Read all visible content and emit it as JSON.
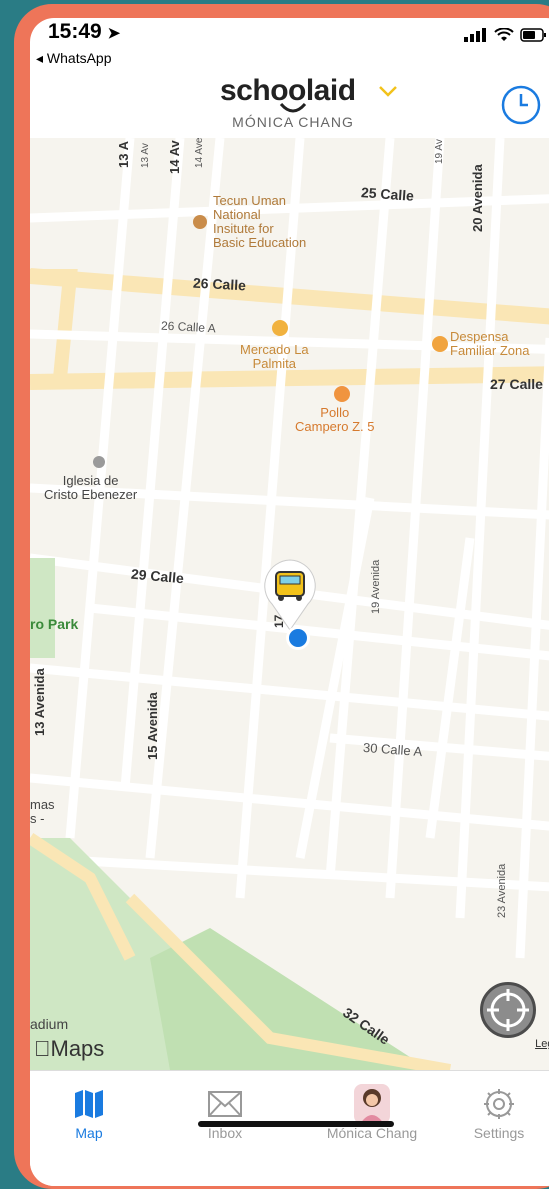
{
  "status": {
    "time": "15:49",
    "back_app": "◂ WhatsApp"
  },
  "header": {
    "logo": "schoolaid",
    "user": "MÓNICA CHANG"
  },
  "map": {
    "streets": {
      "s25": "25 Calle",
      "s26": "26 Calle",
      "s26a": "26 Calle A",
      "s27": "27 Calle",
      "s29": "29 Calle",
      "s30a": "30 Calle A",
      "s32": "32 Calle",
      "a13top": "13 A",
      "a13av": "13 Av",
      "a14av": "14 Av",
      "a14ave": "14 Ave",
      "a19": "19 Av",
      "a20": "20 Avenida",
      "a13": "13 Avenida",
      "a15": "15 Avenida",
      "a19b": "19 Avenida",
      "a23": "23 Avenida",
      "a17": "17"
    },
    "pois": {
      "school": [
        "Tecun Uman",
        "National",
        "Insitute for",
        "Basic Education"
      ],
      "market": [
        "Mercado La",
        "Palmita"
      ],
      "despensa": [
        "Despensa",
        "Familiar Zona"
      ],
      "pollo": [
        "Pollo",
        "Campero Z. 5"
      ],
      "church": [
        "Iglesia de",
        "Cristo Ebenezer"
      ],
      "park": "ro Park",
      "mas": [
        "mas",
        "s -"
      ],
      "stadium": "adium"
    },
    "brand": "Maps",
    "legal": "Legal"
  },
  "tabs": [
    {
      "label": "Map",
      "icon": "map-icon",
      "active": true
    },
    {
      "label": "Inbox",
      "icon": "envelope-icon",
      "active": false
    },
    {
      "label": "Mónica Chang",
      "icon": "avatar",
      "active": false
    },
    {
      "label": "Settings",
      "icon": "gear-icon",
      "active": false
    }
  ],
  "colors": {
    "accent": "#1a7be0",
    "logo_accent": "#f2c21b",
    "frame": "#ee7559",
    "background": "#2a7c85"
  }
}
